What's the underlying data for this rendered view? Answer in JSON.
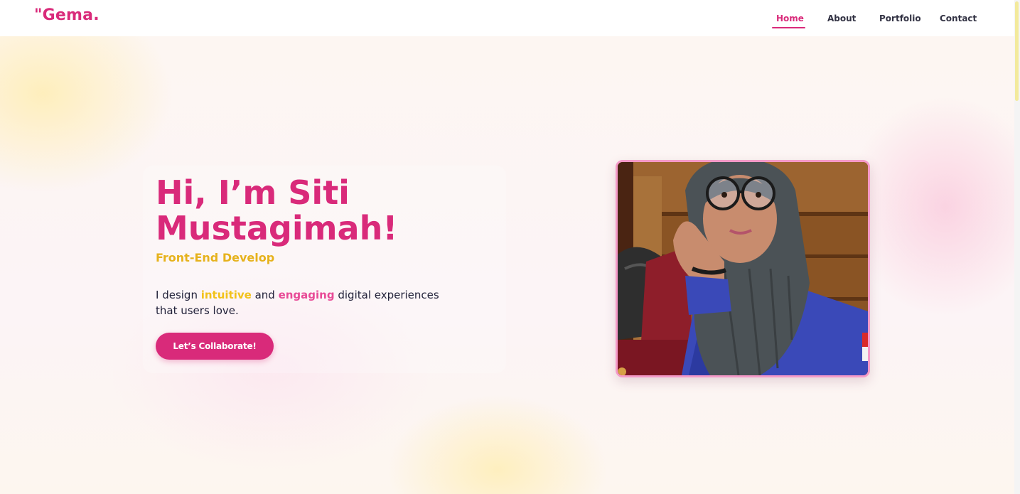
{
  "header": {
    "logo": "\"Gema.",
    "nav": [
      {
        "label": "Home",
        "active": true
      },
      {
        "label": "About",
        "active": false
      },
      {
        "label": "Portfolio",
        "active": false
      },
      {
        "label": "Contact",
        "active": false
      }
    ]
  },
  "hero": {
    "headline": "Hi, I’m Siti Mustagimah!",
    "role": "Front-End Develop",
    "tagline": {
      "prefix": "I design ",
      "highlight1": "intuitive",
      "middle": " and ",
      "highlight2": "engaging",
      "suffix": " digital experiences that users love."
    },
    "cta_label": "Let’s Collaborate!",
    "photo_icon": "portrait-photo"
  },
  "colors": {
    "brand_pink": "#d92a7a",
    "accent_yellow": "#e6b21c",
    "highlight_yellow": "#f2c21b",
    "highlight_pink": "#e84b97",
    "photo_border": "#f59ac8"
  }
}
